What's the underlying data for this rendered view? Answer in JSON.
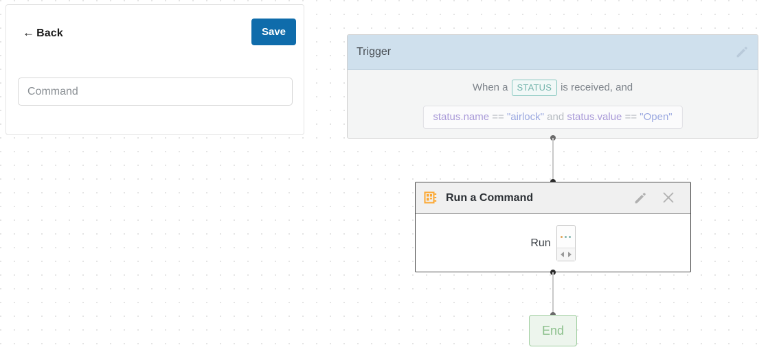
{
  "editor": {
    "back_label": "Back",
    "back_arrow": "←",
    "save_label": "Save",
    "command_value": "",
    "command_placeholder": "Command"
  },
  "trigger": {
    "title": "Trigger",
    "sentence_prefix": "When a",
    "chip_label": "STATUS",
    "sentence_suffix": "is received, and",
    "expression": {
      "ident1": "status.name",
      "op1": "==",
      "str1": "\"airlock\"",
      "conj": "and",
      "ident2": "status.value",
      "op2": "==",
      "str2": "\"Open\""
    },
    "edit_icon": "pencil-icon"
  },
  "command_node": {
    "title": "Run a Command",
    "icon": "command-panel-icon",
    "run_label": "Run",
    "stepper_value": "",
    "edit_icon": "pencil-icon",
    "close_icon": "close-icon"
  },
  "end_node": {
    "label": "End"
  },
  "colors": {
    "accent_blue": "#0f6cab",
    "trigger_header": "#cfe0ed",
    "chip_teal": "#74b4ac",
    "end_green": "#8cc08c",
    "icon_orange": "#fca832"
  }
}
